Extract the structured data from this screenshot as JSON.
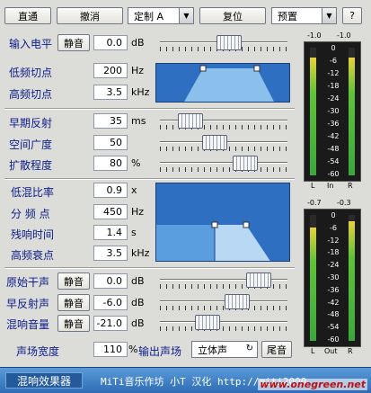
{
  "toolbar": {
    "straight": "直通",
    "undo": "撤消",
    "preset_custom": "定制 A",
    "reset": "复位",
    "presets": "预置",
    "help": "?"
  },
  "input": {
    "label": "输入电平",
    "mute": "静音",
    "value": "0.0",
    "unit": "dB"
  },
  "eq": {
    "low_cut_label": "低频切点",
    "low_cut": "200",
    "low_cut_unit": "Hz",
    "high_cut_label": "高频切点",
    "high_cut": "3.5",
    "high_cut_unit": "kHz"
  },
  "early": {
    "reflect_label": "早期反射",
    "reflect": "35",
    "reflect_unit": "ms",
    "space_label": "空间广度",
    "space": "50",
    "diffuse_label": "扩散程度",
    "diffuse": "80",
    "diffuse_unit": "%"
  },
  "decay": {
    "low_mix_label": "低混比率",
    "low_mix": "0.9",
    "low_mix_unit": "x",
    "freq_label": "分 频 点",
    "freq": "450",
    "freq_unit": "Hz",
    "reverb_time_label": "残响时间",
    "reverb_time": "1.4",
    "reverb_time_unit": "s",
    "hf_decay_label": "高频衰点",
    "hf_decay": "3.5",
    "hf_decay_unit": "kHz"
  },
  "mix": {
    "dry_label": "原始干声",
    "dry_mute": "静音",
    "dry": "0.0",
    "early_label": "早反射声",
    "early_mute": "静音",
    "early": "-6.0",
    "reverb_label": "混响音量",
    "reverb_mute": "静音",
    "reverb": "-21.0",
    "unit": "dB"
  },
  "stereo": {
    "label": "声场宽度",
    "value": "110",
    "unit": "%",
    "output_label": "输出声场",
    "output_mode": "立体声",
    "tail": "尾音"
  },
  "meter_in": {
    "peak_l": "-1.0",
    "peak_r": "-1.0",
    "scale": [
      "0",
      "-6",
      "-12",
      "-18",
      "-24",
      "-30",
      "-36",
      "-42",
      "-48",
      "-54",
      "-60"
    ],
    "l": "L",
    "mid": "In",
    "r": "R",
    "level_l": 0.92,
    "level_r": 0.92
  },
  "meter_out": {
    "peak_l": "-0.7",
    "peak_r": "-0.3",
    "scale": [
      "0",
      "-6",
      "-12",
      "-18",
      "-24",
      "-30",
      "-36",
      "-42",
      "-48",
      "-54",
      "-60"
    ],
    "l": "L",
    "mid": "Out",
    "r": "R",
    "level_l": 0.9,
    "level_r": 0.95
  },
  "sliders": {
    "input": 0.55,
    "reflect": 0.2,
    "space": 0.42,
    "diffuse": 0.7,
    "dry": 0.82,
    "early": 0.62,
    "reverb": 0.35
  },
  "footer": {
    "title": "混响效果器",
    "credit": "MiTi音乐作坊 小T 汉化 http://miti2000.",
    "watermark": "www.onegreen.net"
  }
}
